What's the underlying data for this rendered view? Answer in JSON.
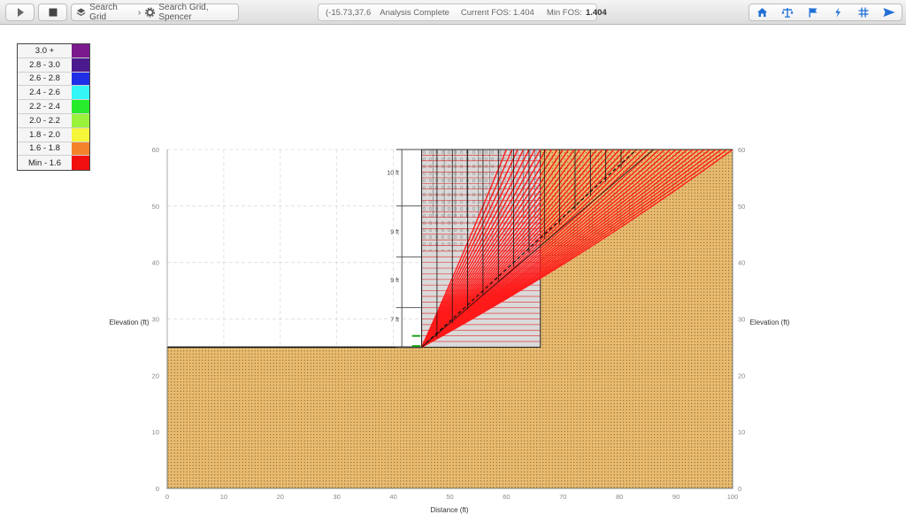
{
  "toolbar": {
    "play_icon": "play-icon",
    "stop_icon": "stop-icon",
    "breadcrumb_1": "Search Grid",
    "breadcrumb_2": "Search Grid, Spencer",
    "coords": "(-15.73,37.6",
    "analysis_status": "Analysis Complete",
    "current_fos_label": "Current FOS: 1.404",
    "min_fos_label": "Min FOS:",
    "min_fos_value": "1.404",
    "right_icons": [
      "home-icon",
      "balance-icon",
      "flag-icon",
      "bolt-icon",
      "grid-icon",
      "send-icon"
    ]
  },
  "legend": {
    "items": [
      {
        "label": "3.0 +",
        "color": "#7a1a8c"
      },
      {
        "label": "2.8 - 3.0",
        "color": "#4b1a8f"
      },
      {
        "label": "2.6 - 2.8",
        "color": "#1f2fe6"
      },
      {
        "label": "2.4 - 2.6",
        "color": "#33f6f6"
      },
      {
        "label": "2.2 - 2.4",
        "color": "#27ec2c"
      },
      {
        "label": "2.0 - 2.2",
        "color": "#9af23a"
      },
      {
        "label": "1.8 - 2.0",
        "color": "#f5f53a"
      },
      {
        "label": "1.6 - 1.8",
        "color": "#f3822a"
      },
      {
        "label": "Min - 1.6",
        "color": "#f20f0f"
      }
    ]
  },
  "colors": {
    "soil": "#e8bb6f",
    "soil_dots": "#6a4a1c",
    "slip_surface": "#ff1a1a",
    "reinforced_zone": "#d8d8d8"
  },
  "plot": {
    "x_axis_label": "Distance (ft)",
    "y_axis_label_left": "Elevation (ft)",
    "y_axis_label_right": "Elevation (ft)",
    "x_ticks": [
      "0",
      "10",
      "20",
      "30",
      "40",
      "50",
      "60",
      "70",
      "80",
      "90",
      "100"
    ],
    "y_ticks": [
      "0",
      "10",
      "20",
      "30",
      "40",
      "50",
      "60"
    ],
    "xlim": [
      0,
      100
    ],
    "ylim": [
      0,
      60
    ],
    "grid": true
  },
  "annotations": {
    "wall_segments": [
      {
        "label": "10 ft",
        "y_center": 56
      },
      {
        "label": "9 ft",
        "y_center": 45.5
      },
      {
        "label": "9 ft",
        "y_center": 37
      },
      {
        "label": "7 ft",
        "y_center": 30
      }
    ]
  },
  "model": {
    "ground_elevation": 25,
    "wall_toe_x": 45,
    "wall_top_elevation": 60,
    "reinforced_zone_right_x": 66,
    "crest_x": 100,
    "slope_toe_x": 66,
    "slope_toe_elevation": 36
  }
}
